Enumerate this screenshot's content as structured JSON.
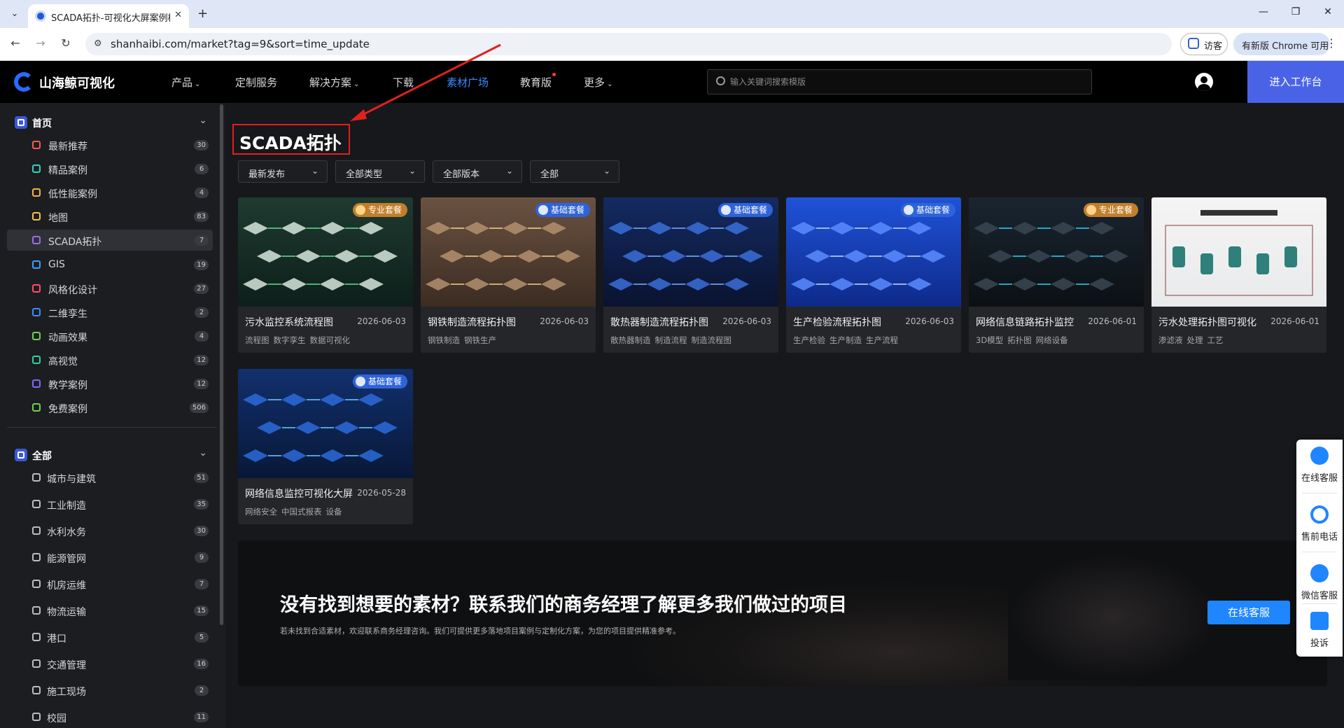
{
  "browser": {
    "tab_title": "SCADA拓扑-可视化大屏案例模",
    "url": "shanhaibi.com/market?tag=9&sort=time_update",
    "guest_label": "访客",
    "update_label": "有新版 Chrome 可用"
  },
  "header": {
    "logo": "山海鲸可视化",
    "nav": [
      {
        "label": "产品",
        "caret": true
      },
      {
        "label": "定制服务",
        "caret": false
      },
      {
        "label": "解决方案",
        "caret": true
      },
      {
        "label": "下载",
        "caret": false
      },
      {
        "label": "素材广场",
        "caret": false,
        "active": true
      },
      {
        "label": "教育版",
        "caret": false,
        "dot": true
      },
      {
        "label": "更多",
        "caret": true
      }
    ],
    "search_placeholder": "输入关键词搜索模版",
    "workbench_label": "进入工作台"
  },
  "sidebar": {
    "home_group": "首页",
    "home_items": [
      {
        "label": "最新推荐",
        "count": "30",
        "color": "#ff5a4a"
      },
      {
        "label": "精品案例",
        "count": "6",
        "color": "#2fd3c2"
      },
      {
        "label": "低性能案例",
        "count": "4",
        "color": "#f5b53b"
      },
      {
        "label": "地图",
        "count": "83",
        "color": "#f5c342"
      },
      {
        "label": "SCADA拓扑",
        "count": "7",
        "color": "#9b6cf0",
        "active": true
      },
      {
        "label": "GIS",
        "count": "19",
        "color": "#3aa0ff"
      },
      {
        "label": "风格化设计",
        "count": "27",
        "color": "#ff4d6a"
      },
      {
        "label": "二维孪生",
        "count": "2",
        "color": "#3b8bff"
      },
      {
        "label": "动画效果",
        "count": "4",
        "color": "#6fd34c"
      },
      {
        "label": "高视觉",
        "count": "12",
        "color": "#2fd39a"
      },
      {
        "label": "教学案例",
        "count": "12",
        "color": "#7a6cff"
      },
      {
        "label": "免费案例",
        "count": "506",
        "color": "#6fd34c"
      }
    ],
    "all_group": "全部",
    "all_items": [
      {
        "label": "城市与建筑",
        "count": "51"
      },
      {
        "label": "工业制造",
        "count": "35"
      },
      {
        "label": "水利水务",
        "count": "30"
      },
      {
        "label": "能源管网",
        "count": "9"
      },
      {
        "label": "机房运维",
        "count": "7"
      },
      {
        "label": "物流运输",
        "count": "15"
      },
      {
        "label": "港口",
        "count": "5"
      },
      {
        "label": "交通管理",
        "count": "16"
      },
      {
        "label": "施工现场",
        "count": "2"
      },
      {
        "label": "校园",
        "count": "11"
      }
    ]
  },
  "main": {
    "page_title": "SCADA拓扑",
    "filters": [
      "最新发布",
      "全部类型",
      "全部版本",
      "全部"
    ],
    "cards": [
      {
        "title": "污水监控系统流程图",
        "date": "2026-06-03",
        "tags": [
          "流程图",
          "数字孪生",
          "数据可视化"
        ],
        "badge": "专业套餐",
        "badge_type": "pro",
        "theme": "green"
      },
      {
        "title": "钢铁制造流程拓扑图",
        "date": "2026-06-03",
        "tags": [
          "钢铁制造",
          "钢铁生产"
        ],
        "badge": "基础套餐",
        "badge_type": "basic",
        "theme": "brown"
      },
      {
        "title": "散热器制造流程拓扑图",
        "date": "2026-06-03",
        "tags": [
          "散热器制造",
          "制造流程",
          "制造流程图"
        ],
        "badge": "基础套餐",
        "badge_type": "basic",
        "theme": "navy"
      },
      {
        "title": "生产检验流程拓扑图",
        "date": "2026-06-03",
        "tags": [
          "生产检验",
          "生产制造",
          "生产流程"
        ],
        "badge": "基础套餐",
        "badge_type": "basic",
        "theme": "blue"
      },
      {
        "title": "网络信息链路拓扑监控",
        "date": "2026-06-01",
        "tags": [
          "3D模型",
          "拓扑图",
          "网络设备"
        ],
        "badge": "专业套餐",
        "badge_type": "pro",
        "theme": "dark"
      },
      {
        "title": "污水处理拓扑图可视化",
        "date": "2026-06-01",
        "tags": [
          "渗滤液",
          "处理",
          "工艺"
        ],
        "badge": "",
        "badge_type": "",
        "theme": "light"
      },
      {
        "title": "网络信息监控可视化大屏",
        "date": "2026-05-28",
        "tags": [
          "网络安全",
          "中国式报表",
          "设备"
        ],
        "badge": "基础套餐",
        "badge_type": "basic",
        "theme": "deepblue"
      }
    ]
  },
  "banner": {
    "title": "没有找到想要的素材？联系我们的商务经理了解更多我们做过的项目",
    "subtitle": "若未找到合适素材，欢迎联系商务经理咨询。我们可提供更多落地项目案例与定制化方案，为您的项目提供精准参考。",
    "button": "在线客服"
  },
  "service_bar": [
    "在线客服",
    "售前电话",
    "微信客服",
    "投诉"
  ]
}
